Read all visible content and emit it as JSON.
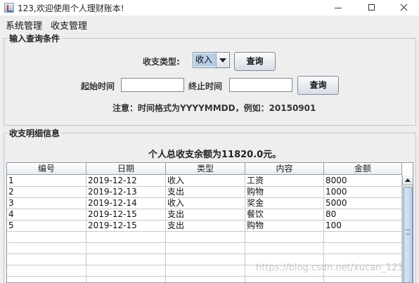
{
  "window": {
    "title": "123,欢迎使用个人理财账本!"
  },
  "menubar": {
    "items": [
      "系统管理",
      "收支管理"
    ]
  },
  "query_panel": {
    "title": "输入查询条件",
    "type_label": "收支类型:",
    "type_value": "收入",
    "query_button": "查询",
    "start_label": "起始时间",
    "start_value": "",
    "end_label": "终止时间",
    "end_value": "",
    "query_button2": "查询",
    "note": "注意：时间格式为YYYYMMDD，例如：20150901"
  },
  "detail_panel": {
    "title": "收支明细信息",
    "summary": "个人总收支余额为11820.0元。"
  },
  "table": {
    "columns": [
      "编号",
      "日期",
      "类型",
      "内容",
      "金额"
    ],
    "rows": [
      [
        "1",
        "2019-12-12",
        "收入",
        "工资",
        "8000"
      ],
      [
        "2",
        "2019-12-13",
        "支出",
        "购物",
        "1000"
      ],
      [
        "3",
        "2019-12-14",
        "收入",
        "奖金",
        "5000"
      ],
      [
        "4",
        "2019-12-15",
        "支出",
        "餐饮",
        "80"
      ],
      [
        "5",
        "2019-12-15",
        "支出",
        "购物",
        "100"
      ]
    ]
  },
  "watermark": "https://blog.csdn.net/xucan_123"
}
